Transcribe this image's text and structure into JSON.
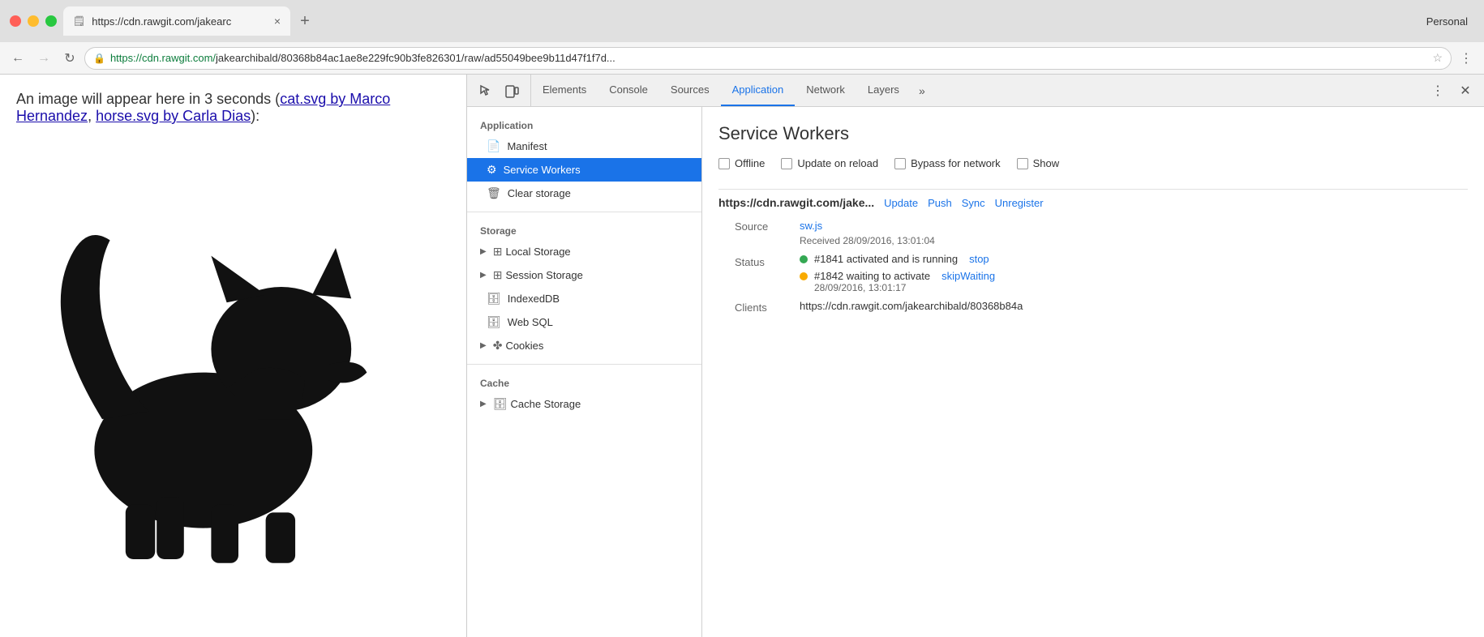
{
  "browser": {
    "tab_url": "https://cdn.rawgit.com/jakearc",
    "tab_close": "×",
    "personal_label": "Personal",
    "full_url_prefix": "https://cdn.rawgit.com/",
    "full_url_rest": "jakearchibald/80368b84ac1ae8e229fc90b3fe826301/raw/ad55049bee9b11d47f1f7d...",
    "back_btn": "←",
    "forward_btn": "→",
    "refresh_btn": "↻",
    "more_menu": "⋮"
  },
  "page": {
    "intro_text_pre": "An image will appear here in 3 seconds (",
    "link1_text": "cat.svg by Marco Hernandez",
    "link_sep": ", ",
    "link2_text": "horse.svg by Carla Dias",
    "intro_text_post": "):"
  },
  "devtools": {
    "tabs": [
      {
        "id": "elements",
        "label": "Elements"
      },
      {
        "id": "console",
        "label": "Console"
      },
      {
        "id": "sources",
        "label": "Sources"
      },
      {
        "id": "application",
        "label": "Application",
        "active": true
      },
      {
        "id": "network",
        "label": "Network"
      },
      {
        "id": "layers",
        "label": "Layers"
      }
    ],
    "tabs_more": "»",
    "sidebar": {
      "sections": [
        {
          "title": "Application",
          "items": [
            {
              "id": "manifest",
              "label": "Manifest",
              "icon": "📄",
              "active": false,
              "expandable": false
            },
            {
              "id": "service-workers",
              "label": "Service Workers",
              "icon": "⚙",
              "active": true,
              "expandable": false
            },
            {
              "id": "clear-storage",
              "label": "Clear storage",
              "icon": "🗑",
              "active": false,
              "expandable": false
            }
          ]
        },
        {
          "title": "Storage",
          "items": [
            {
              "id": "local-storage",
              "label": "Local Storage",
              "icon": "▶",
              "active": false,
              "expandable": true
            },
            {
              "id": "session-storage",
              "label": "Session Storage",
              "icon": "▶",
              "active": false,
              "expandable": true
            },
            {
              "id": "indexeddb",
              "label": "IndexedDB",
              "icon": "",
              "active": false,
              "expandable": false,
              "db_icon": true
            },
            {
              "id": "web-sql",
              "label": "Web SQL",
              "icon": "",
              "active": false,
              "expandable": false,
              "db_icon": true
            },
            {
              "id": "cookies",
              "label": "Cookies",
              "icon": "▶",
              "active": false,
              "expandable": true,
              "cookie_icon": true
            }
          ]
        },
        {
          "title": "Cache",
          "items": [
            {
              "id": "cache-storage",
              "label": "Cache Storage",
              "icon": "▶",
              "active": false,
              "expandable": true,
              "db_icon": true
            }
          ]
        }
      ]
    },
    "main": {
      "panel_title": "Service Workers",
      "checkboxes": [
        {
          "id": "offline",
          "label": "Offline",
          "checked": false
        },
        {
          "id": "update-on-reload",
          "label": "Update on reload",
          "checked": false
        },
        {
          "id": "bypass-for-network",
          "label": "Bypass for network",
          "checked": false
        },
        {
          "id": "show",
          "label": "Show",
          "checked": false
        }
      ],
      "sw_entry": {
        "url": "https://cdn.rawgit.com/jake...",
        "actions": [
          "Update",
          "Push",
          "Sync",
          "Unregister"
        ],
        "source_label": "Source",
        "source_file": "sw.js",
        "received": "Received 28/09/2016, 13:01:04",
        "status_label": "Status",
        "status_entries": [
          {
            "dot_color": "green",
            "text": "#1841 activated and is running",
            "action_link": "stop",
            "has_time": false
          },
          {
            "dot_color": "orange",
            "text": "#1842 waiting to activate",
            "action_link": "skipWaiting",
            "time": "28/09/2016, 13:01:17",
            "has_time": true
          }
        ],
        "clients_label": "Clients",
        "clients_url": "https://cdn.rawgit.com/jakearchibald/80368b84a"
      }
    }
  }
}
